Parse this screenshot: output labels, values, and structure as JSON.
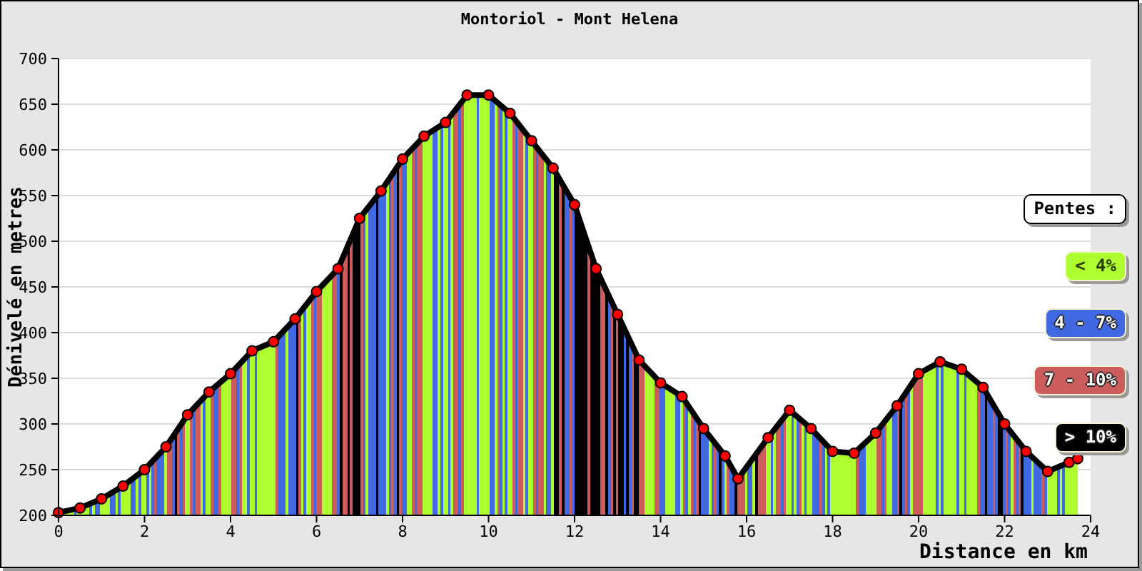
{
  "chart": {
    "chart_data": {
      "type": "area",
      "title": "Montoriol - Mont Helena",
      "xlabel": "Distance en km",
      "ylabel": "Dénivelé en metres",
      "x": [
        0,
        0.5,
        1,
        1.5,
        2,
        2.5,
        3,
        3.5,
        4,
        4.5,
        5,
        5.5,
        6,
        6.5,
        7,
        7.5,
        8,
        8.5,
        9,
        9.5,
        10,
        10.5,
        11,
        11.5,
        12,
        12.5,
        13,
        13.5,
        14,
        14.5,
        15,
        15.5,
        15.8,
        16.5,
        17,
        17.5,
        18,
        18.5,
        19,
        19.5,
        20,
        20.5,
        21,
        21.5,
        22,
        22.5,
        23,
        23.5,
        23.7
      ],
      "series": [
        {
          "color": "#ff0000",
          "values": [
            203,
            208,
            218,
            232,
            250,
            275,
            310,
            335,
            355,
            380,
            390,
            415,
            445,
            470,
            525,
            555,
            590,
            615,
            630,
            660,
            660,
            640,
            610,
            580,
            540,
            470,
            420,
            370,
            345,
            330,
            295,
            265,
            240,
            285,
            315,
            295,
            270,
            268,
            290,
            320,
            355,
            368,
            360,
            340,
            300,
            270,
            248,
            258,
            262
          ]
        }
      ],
      "grid": true,
      "xlim": [
        0,
        24
      ],
      "ylim": [
        200,
        700
      ],
      "xticks": [
        0,
        2,
        4,
        6,
        8,
        10,
        12,
        14,
        16,
        18,
        20,
        22,
        24
      ],
      "yticks": [
        200,
        250,
        300,
        350,
        400,
        450,
        500,
        550,
        600,
        650,
        700
      ]
    }
  },
  "legend": {
    "title": "Pentes :",
    "items": [
      {
        "label": "< 4%",
        "color": "#adff2f"
      },
      {
        "label": "4 - 7%",
        "color": "#4169e1"
      },
      {
        "label": "7 - 10%",
        "color": "#cd5c5c"
      },
      {
        "label": "> 10%",
        "color": "#000000"
      }
    ]
  }
}
